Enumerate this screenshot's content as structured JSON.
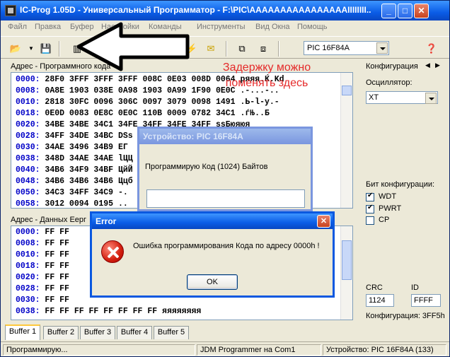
{
  "window": {
    "title": "IC-Prog 1.05D - Универсальный Программатор - F:\\PIC\\AAAAAAAAAAAAAAAAIIIIIIII..",
    "controls": {
      "minimize": "_",
      "maximize": "□",
      "close": "✕"
    }
  },
  "menu": [
    "Файл",
    "Правка",
    "Буфер",
    "Настройки",
    "Команды",
    "Инструменты",
    "Вид Окна",
    "Помощь"
  ],
  "toolbar": {
    "device": "PIC 16F84A",
    "icons": [
      "open-folder-icon",
      "save-icon",
      "chip-icon",
      "read-icon",
      "program-icon",
      "erase-icon",
      "verify-icon",
      "blank-check-icon",
      "window-icon",
      "window-alt-icon",
      "help-icon"
    ]
  },
  "annotation": {
    "line1": "Задержку можно",
    "line2": "поменять здесь"
  },
  "program_panel": {
    "header": "Адрес - Программного кода",
    "rows": [
      {
        "addr": "0000:",
        "words": "28F0 3FFF 3FFF 3FFF 008C 0E03 008D 0064",
        "ascii": "ряяя.Ќ.Kd"
      },
      {
        "addr": "0008:",
        "words": "0A8E 1903 038E 0A98 1903 0A99 1F90 0E0C",
        "ascii": ".-...-.."
      },
      {
        "addr": "0010:",
        "words": "2818 30FC 0096 306C 0097 3079 0098 1491",
        "ascii": ".Ь-l-y.-"
      },
      {
        "addr": "0018:",
        "words": "0E0D 0083 0E8C 0E0C 110B 0009 0782 34C1",
        "ascii": ".ѓЊ..Б"
      },
      {
        "addr": "0020:",
        "words": "34BE 34BE 34C1 34FE 34FF 34FE 34FF",
        "ascii": "ssБюяюя"
      },
      {
        "addr": "0028:",
        "words": "34FF 34DE 34BC",
        "ascii": "DSs"
      },
      {
        "addr": "0030:",
        "words": "34AE 3496 34B9",
        "ascii": "ЕГ"
      },
      {
        "addr": "0038:",
        "words": "348D 34AE 34AE",
        "ascii": "lЦЦ"
      },
      {
        "addr": "0040:",
        "words": "34B6 34F9 34BF",
        "ascii": "ЦйЙ"
      },
      {
        "addr": "0048:",
        "words": "34B6 34B6 34B6",
        "ascii": "Ццб"
      },
      {
        "addr": "0050:",
        "words": "34C3 34FF 34C9",
        "ascii": "-."
      },
      {
        "addr": "0058:",
        "words": "3012 0094 0195",
        "ascii": ".."
      }
    ]
  },
  "eeprom_panel": {
    "header": "Адрес - Данных Еерг",
    "rows": [
      {
        "addr": "0000:",
        "bytes": "FF FF"
      },
      {
        "addr": "0008:",
        "bytes": "FF FF"
      },
      {
        "addr": "0010:",
        "bytes": "FF FF"
      },
      {
        "addr": "0018:",
        "bytes": "FF FF"
      },
      {
        "addr": "0020:",
        "bytes": "FF FF"
      },
      {
        "addr": "0028:",
        "bytes": "FF FF"
      },
      {
        "addr": "0030:",
        "bytes": "FF FF"
      },
      {
        "addr": "0038:",
        "bytes": "FF FF FF FF FF FF FF FF",
        "ascii": "яяяяяяяя"
      }
    ]
  },
  "config": {
    "title": "Конфигурация",
    "osc_label": "Осциллятор:",
    "osc_value": "XT",
    "bits_label": "Бит конфигурации:",
    "bits": [
      {
        "label": "WDT",
        "checked": true
      },
      {
        "label": "PWRT",
        "checked": true
      },
      {
        "label": "CP",
        "checked": false
      }
    ],
    "crc_label": "CRC",
    "crc_value": "1124",
    "id_label": "ID",
    "id_value": "FFFF",
    "config_word": "Конфигурация: 3FF5h"
  },
  "tabs": [
    "Buffer 1",
    "Buffer 2",
    "Buffer 3",
    "Buffer 4",
    "Buffer 5"
  ],
  "status": {
    "left": "Программирую...",
    "middle": "JDM Programmer на Com1",
    "right": "Устройство: PIC 16F84A  (133)"
  },
  "progress_dialog": {
    "title": "Устройство: PIC 16F84A",
    "message": "Программирую Код (1024) Байтов"
  },
  "error_dialog": {
    "title": "Error",
    "message": "Ошибка программирования Кода по адресу 0000h !",
    "ok": "OK",
    "close": "✕"
  }
}
